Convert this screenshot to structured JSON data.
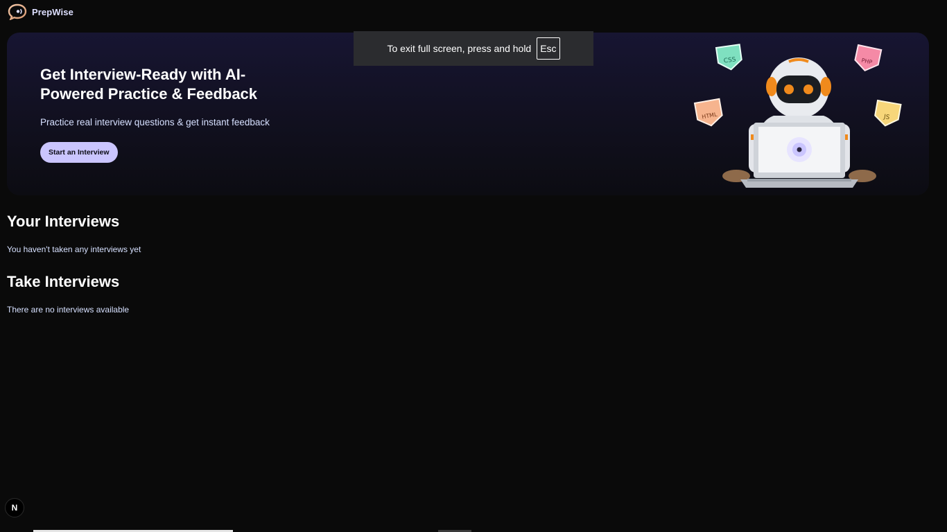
{
  "app": {
    "name": "PrepWise"
  },
  "hero": {
    "title": "Get Interview-Ready with AI-Powered Practice & Feedback",
    "subtitle": "Practice real interview questions & get instant feedback",
    "cta_label": "Start an Interview",
    "badges": [
      "CSS",
      "PHP",
      "HTML",
      "JS"
    ]
  },
  "your_interviews": {
    "title": "Your Interviews",
    "empty_text": "You haven't taken any interviews yet"
  },
  "take_interviews": {
    "title": "Take Interviews",
    "empty_text": "There are no interviews available"
  },
  "fullscreen_notice": {
    "text": "To exit full screen, press and hold",
    "key": "Esc"
  },
  "dev_badge": {
    "label": "N"
  },
  "colors": {
    "background": "#0a0a0a",
    "accent": "#cac5fe",
    "text_muted": "#d6e0ff"
  }
}
